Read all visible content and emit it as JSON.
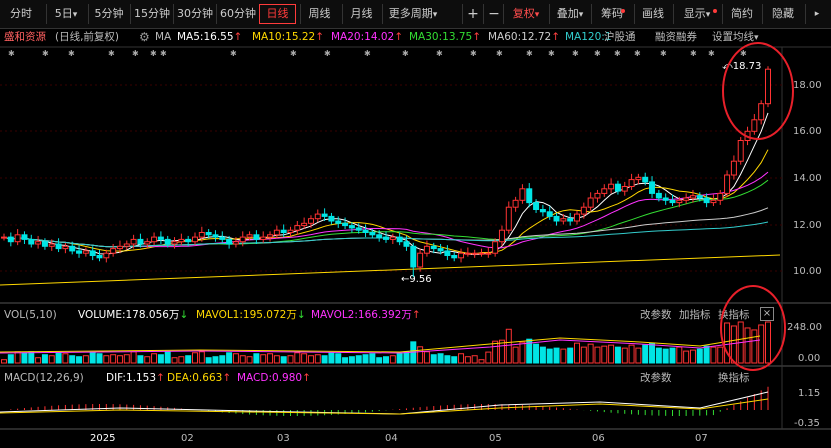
{
  "toolbar": {
    "periods": [
      "分时",
      "5日",
      "5分钟",
      "15分钟",
      "30分钟",
      "60分钟",
      "日线",
      "周线",
      "月线",
      "更多周期"
    ],
    "period_extras": [
      "",
      "▾",
      "",
      "",
      "",
      "",
      "",
      "",
      "",
      "▾"
    ],
    "active": "日线",
    "plus": "+",
    "minus": "−",
    "fuquan": "复权",
    "fuquan_arrow": "▾",
    "dieja": "叠加",
    "dieja_arrow": "▾",
    "chouma": "筹码",
    "huaxian": "画线",
    "xianshi": "显示",
    "jianyue": "简约",
    "yincang": "隐藏"
  },
  "main_legend": {
    "stock": "盛和资源",
    "mode": "(日线,前复权)",
    "ma_label": "MA",
    "ma5": "MA5:16.55",
    "ma10": "MA10:15.22",
    "ma20": "MA20:14.02",
    "ma30": "MA30:13.75",
    "ma60": "MA60:12.72",
    "ma120": "MA120:1",
    "up_arrow": "↑",
    "hgt": "沪股通",
    "rzrq": "融资融券",
    "settings": "设置均线",
    "settings_arrow": "▾",
    "colors": {
      "ma5": "#ffffff",
      "ma10": "#ffd800",
      "ma20": "#ff33ff",
      "ma30": "#33dd33",
      "ma60": "#cccccc",
      "ma120": "#33cccc"
    }
  },
  "price_axis": [
    "18.00",
    "16.00",
    "14.00",
    "12.00",
    "10.00"
  ],
  "annotations": {
    "high": "18.73",
    "low": "9.56"
  },
  "vol_legend": {
    "title": "VOL(5,10)",
    "volume": "VOLUME:178.056万",
    "mavol1": "MAVOL1:195.072万",
    "mavol2": "MAVOL2:166.392万",
    "down_arrow": "↓",
    "up_arrow": "↑",
    "gai": "改参数",
    "jia": "加指标",
    "huan": "换指标",
    "close": "×"
  },
  "vol_axis": [
    "248.00",
    "0.00"
  ],
  "macd_legend": {
    "title": "MACD(12,26,9)",
    "dif": "DIF:1.153",
    "dea": "DEA:0.663",
    "macd": "MACD:0.980",
    "up_arrow": "↑",
    "gai": "改参数",
    "huan": "换指标"
  },
  "macd_axis": [
    "1.15",
    "-0.35"
  ],
  "x_axis": [
    "2025",
    "02",
    "03",
    "04",
    "05",
    "06",
    "07"
  ],
  "chart_data": {
    "type": "candlestick",
    "ylim": [
      9.0,
      19.0
    ],
    "high": 18.73,
    "low": 9.56,
    "close_series": [
      11.3,
      11.1,
      11.4,
      11.2,
      11.0,
      11.1,
      10.9,
      11.0,
      10.8,
      10.9,
      10.7,
      10.6,
      10.7,
      10.5,
      10.4,
      10.6,
      10.8,
      10.9,
      11.0,
      11.2,
      11.0,
      11.1,
      11.3,
      11.2,
      11.0,
      11.1,
      11.2,
      11.1,
      11.3,
      11.5,
      11.4,
      11.3,
      11.2,
      11.0,
      11.1,
      11.3,
      11.4,
      11.2,
      11.3,
      11.4,
      11.6,
      11.5,
      11.6,
      11.8,
      11.9,
      12.1,
      12.3,
      12.2,
      12.0,
      11.9,
      11.8,
      11.7,
      11.6,
      11.5,
      11.4,
      11.3,
      11.2,
      11.3,
      11.1,
      10.9,
      10.0,
      10.6,
      10.9,
      10.8,
      10.7,
      10.5,
      10.4,
      10.6,
      10.6,
      10.6,
      10.6,
      10.6,
      11.1,
      11.6,
      12.6,
      12.9,
      13.4,
      12.8,
      12.5,
      12.4,
      12.2,
      12.0,
      12.1,
      12.0,
      12.3,
      12.6,
      13.0,
      13.2,
      13.4,
      13.6,
      13.3,
      13.5,
      13.8,
      13.9,
      13.7,
      13.2,
      13.0,
      12.9,
      12.8,
      12.9,
      13.0,
      13.1,
      13.0,
      12.8,
      12.9,
      13.2,
      14.0,
      14.6,
      15.5,
      15.9,
      16.4,
      17.1,
      18.6
    ],
    "volume": {
      "ylim": [
        0,
        248
      ],
      "last": 178.056,
      "mavol1": 195.072,
      "mavol2": 166.392,
      "unit": "万"
    },
    "macd": {
      "dif": 1.153,
      "dea": 0.663,
      "macd": 0.98
    }
  }
}
